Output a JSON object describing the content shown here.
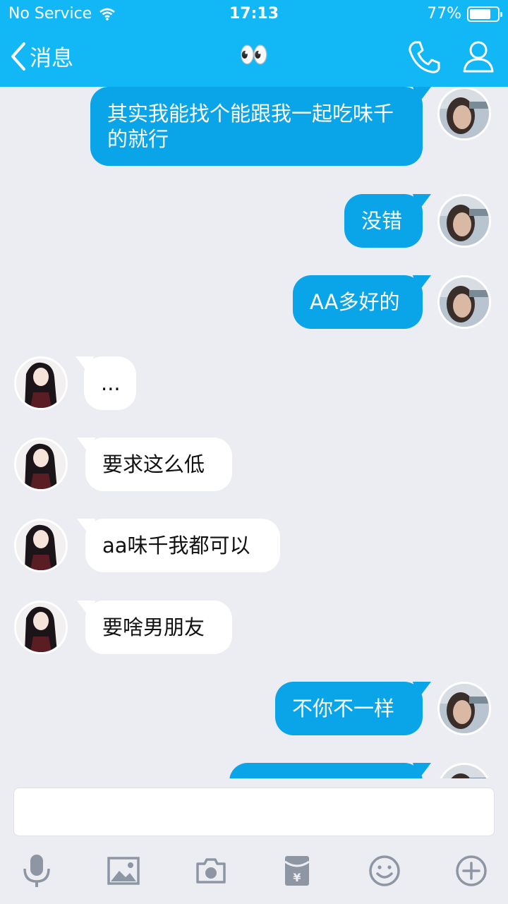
{
  "status_bar": {
    "carrier": "No Service",
    "time": "17:13",
    "battery": "77%",
    "battery_level": 0.77
  },
  "nav": {
    "back_label": "消息",
    "title": "👀"
  },
  "messages": [
    {
      "side": "out",
      "text": "其实我能找个能跟我一起吃味千的就行"
    },
    {
      "side": "out",
      "text": "没错"
    },
    {
      "side": "out",
      "text": "AA多好的"
    },
    {
      "side": "in",
      "text": "..."
    },
    {
      "side": "in",
      "text": "要求这么低"
    },
    {
      "side": "in",
      "text": "aa味千我都可以"
    },
    {
      "side": "in",
      "text": "要啥男朋友"
    },
    {
      "side": "out",
      "text": "不你不一样"
    },
    {
      "side": "out",
      "text": ""
    }
  ],
  "input": {
    "value": "",
    "placeholder": ""
  },
  "toolbar": [
    "microphone-icon",
    "image-icon",
    "camera-icon",
    "red-packet-icon",
    "emoji-icon",
    "plus-icon"
  ],
  "colors": {
    "header": "#12b7f5",
    "bubble_out": "#0aa4e8",
    "bubble_in": "#ffffff",
    "background": "#ebedf2",
    "icon": "#8e95a3"
  }
}
